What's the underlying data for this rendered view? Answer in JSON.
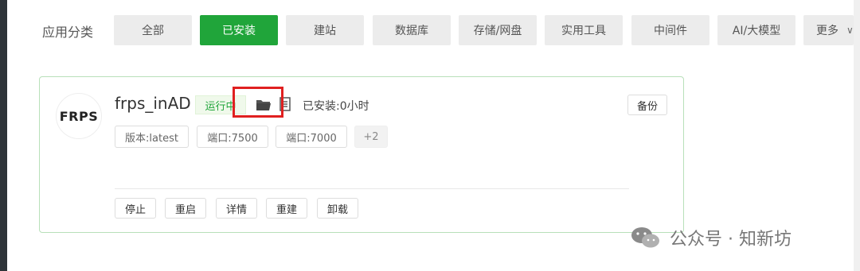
{
  "categories": {
    "label": "应用分类",
    "items": [
      "全部",
      "已安装",
      "建站",
      "数据库",
      "存储/网盘",
      "实用工具",
      "中间件",
      "AI/大模型",
      "更多"
    ],
    "active": "已安装"
  },
  "app": {
    "logo_text": "FRPS",
    "name": "frps_inAD",
    "status": "运行中",
    "installed": "已安装:0小时",
    "backup_label": "备份",
    "tags": [
      "版本:latest",
      "端口:7500",
      "端口:7000",
      "+2"
    ],
    "actions": [
      "停止",
      "重启",
      "详情",
      "重建",
      "卸载"
    ]
  },
  "watermark": {
    "text": "公众号 · 知新坊"
  },
  "colors": {
    "accent": "#20a53a",
    "highlight": "#e02020"
  },
  "icons": {
    "folder": "folder-icon",
    "file": "file-icon",
    "more": "chevron-down-icon",
    "watermark": "wechat-icon"
  }
}
